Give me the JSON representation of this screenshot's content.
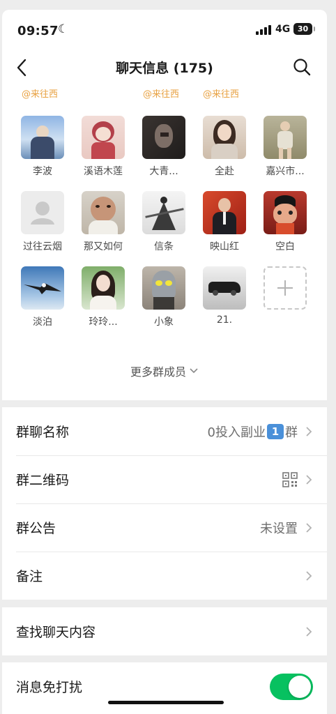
{
  "status": {
    "time": "09:57",
    "network": "4G",
    "battery": "30"
  },
  "nav": {
    "title": "聊天信息 (175)"
  },
  "mentions": [
    "@来往西",
    "@来往西",
    "@来往西"
  ],
  "members": [
    {
      "name": "李波"
    },
    {
      "name": "溪语木莲"
    },
    {
      "name": "大青..."
    },
    {
      "name": "全赴"
    },
    {
      "name": "嘉兴市..."
    },
    {
      "name": "过往云烟"
    },
    {
      "name": "那又如何"
    },
    {
      "name": "信条"
    },
    {
      "name": "映山红"
    },
    {
      "name": "空白"
    },
    {
      "name": "淡泊"
    },
    {
      "name": "玲玲..."
    },
    {
      "name": "小象"
    },
    {
      "name": "21."
    }
  ],
  "more_members": "更多群成员",
  "settings": {
    "group_name": {
      "label": "群聊名称",
      "value_prefix": "0投入副业",
      "value_badge": "1",
      "value_suffix": "群"
    },
    "qr_code": {
      "label": "群二维码"
    },
    "announcement": {
      "label": "群公告",
      "value": "未设置"
    },
    "remark": {
      "label": "备注"
    },
    "search_history": {
      "label": "查找聊天内容"
    },
    "mute": {
      "label": "消息免打扰",
      "enabled": true
    }
  },
  "colors": {
    "accent": "#07c160",
    "mention": "#e8a141",
    "background": "#ededed"
  }
}
